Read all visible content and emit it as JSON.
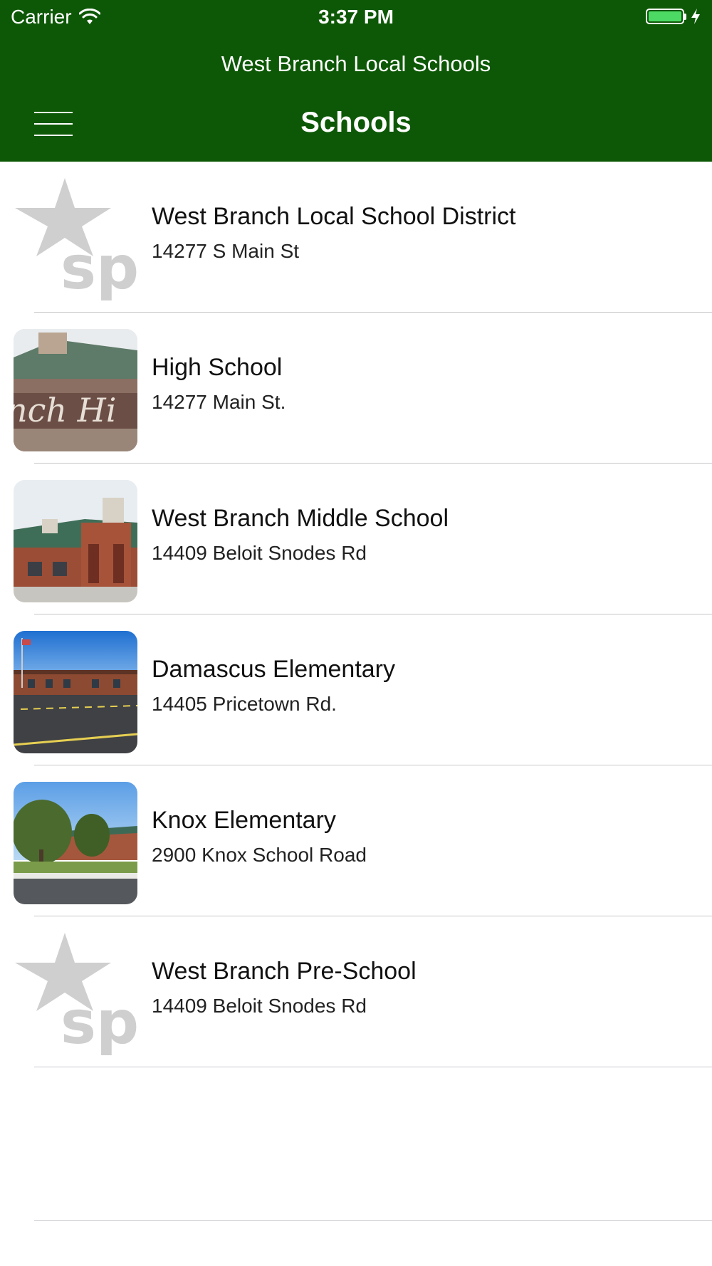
{
  "status_bar": {
    "carrier": "Carrier",
    "time": "3:37 PM",
    "wifi_icon": "wifi-icon",
    "battery_icon": "battery-icon",
    "charging_icon": "bolt-icon"
  },
  "header": {
    "app_title": "West Branch Local Schools",
    "page_title": "Schools",
    "menu_icon": "hamburger-menu-icon",
    "background_color": "#0d5806"
  },
  "schools": [
    {
      "name": "West Branch Local School District",
      "address": "14277 S Main St",
      "thumbnail": "sp-logo-placeholder"
    },
    {
      "name": "High School",
      "address": "14277 Main St.",
      "thumbnail": "high-school-photo"
    },
    {
      "name": "West Branch Middle School",
      "address": "14409 Beloit Snodes Rd",
      "thumbnail": "middle-school-photo"
    },
    {
      "name": "Damascus Elementary",
      "address": "14405 Pricetown Rd.",
      "thumbnail": "damascus-elementary-photo"
    },
    {
      "name": "Knox Elementary",
      "address": "2900 Knox School Road",
      "thumbnail": "knox-elementary-photo"
    },
    {
      "name": "West Branch Pre-School",
      "address": "14409 Beloit Snodes Rd",
      "thumbnail": "sp-logo-placeholder"
    }
  ]
}
